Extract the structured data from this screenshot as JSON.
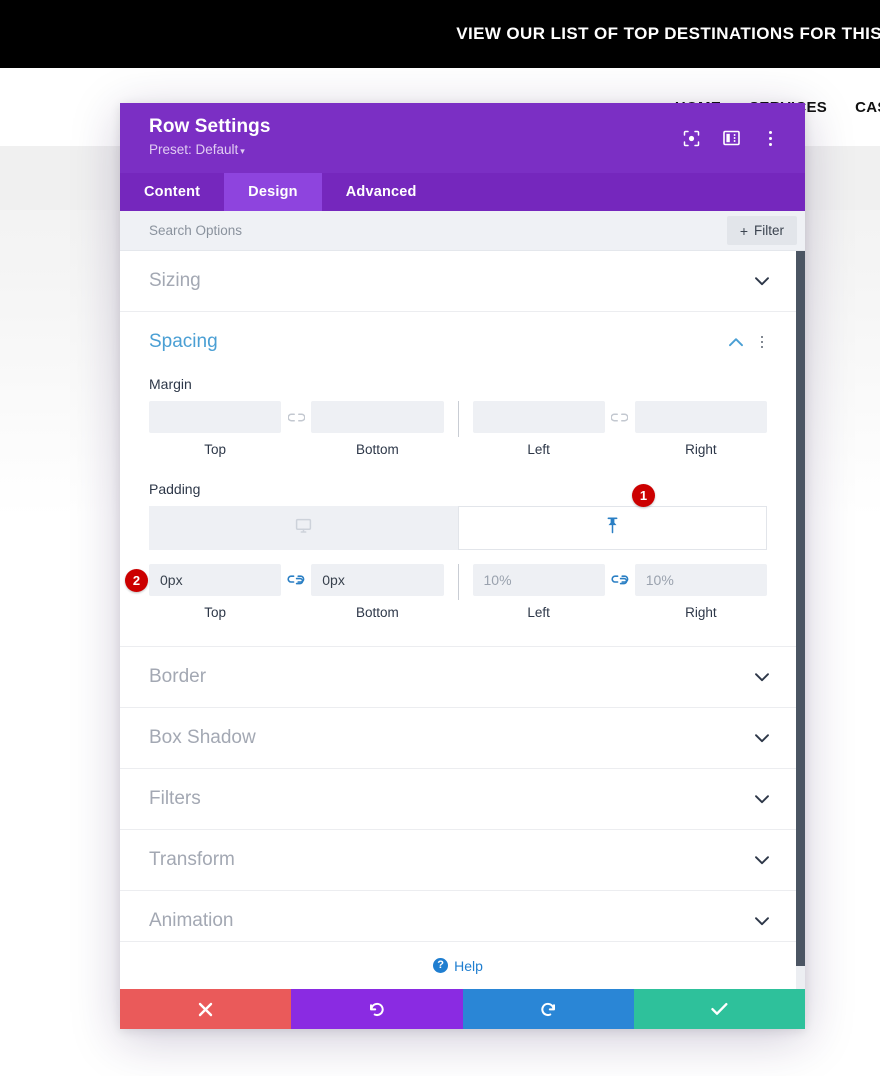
{
  "site": {
    "banner_text": "VIEW OUR LIST OF TOP DESTINATIONS FOR THIS",
    "nav": [
      {
        "label": "HOME"
      },
      {
        "label": "SERVICES"
      },
      {
        "label": "CASE"
      }
    ]
  },
  "modal": {
    "title": "Row Settings",
    "preset_label": "Preset: Default",
    "preset_caret": "▾",
    "header_icons": [
      {
        "name": "focus-icon"
      },
      {
        "name": "layout-panel-icon"
      },
      {
        "name": "more-options-icon"
      }
    ],
    "tabs": [
      {
        "label": "Content",
        "active": false
      },
      {
        "label": "Design",
        "active": true
      },
      {
        "label": "Advanced",
        "active": false
      }
    ],
    "search": {
      "placeholder": "Search Options",
      "value": ""
    },
    "filter_button": {
      "plus": "+",
      "label": "Filter"
    },
    "sections": [
      {
        "name": "sizing",
        "title": "Sizing",
        "open": false
      },
      {
        "name": "spacing",
        "title": "Spacing",
        "open": true
      },
      {
        "name": "border",
        "title": "Border",
        "open": false
      },
      {
        "name": "box-shadow",
        "title": "Box Shadow",
        "open": false
      },
      {
        "name": "filters",
        "title": "Filters",
        "open": false
      },
      {
        "name": "transform",
        "title": "Transform",
        "open": false
      },
      {
        "name": "animation",
        "title": "Animation",
        "open": false
      }
    ],
    "spacing": {
      "margin": {
        "label": "Margin",
        "linked_tb": false,
        "linked_lr": false,
        "top": {
          "value": "",
          "placeholder": "",
          "sublabel": "Top"
        },
        "bottom": {
          "value": "",
          "placeholder": "",
          "sublabel": "Bottom"
        },
        "left": {
          "value": "",
          "placeholder": "",
          "sublabel": "Left"
        },
        "right": {
          "value": "",
          "placeholder": "",
          "sublabel": "Right"
        }
      },
      "padding": {
        "label": "Padding",
        "linked_tb": true,
        "linked_lr": true,
        "responsive_tabs": [
          {
            "name": "desktop-tab",
            "icon": "desktop-icon",
            "active": false
          },
          {
            "name": "pin-tab",
            "icon": "pin-icon",
            "active": true
          }
        ],
        "top": {
          "value": "0px",
          "placeholder": "",
          "sublabel": "Top",
          "muted": false
        },
        "bottom": {
          "value": "0px",
          "placeholder": "",
          "sublabel": "Bottom",
          "muted": false
        },
        "left": {
          "value": "10%",
          "placeholder": "",
          "sublabel": "Left",
          "muted": true
        },
        "right": {
          "value": "10%",
          "placeholder": "",
          "sublabel": "Right",
          "muted": true
        }
      }
    },
    "callouts": [
      {
        "number": "1"
      },
      {
        "number": "2"
      }
    ],
    "help": {
      "icon_glyph": "?",
      "label": "Help"
    },
    "footer_buttons": [
      {
        "name": "cancel-button",
        "icon": "close-icon",
        "color": "#ea5a5a"
      },
      {
        "name": "undo-button",
        "icon": "undo-icon",
        "color": "#8A2BE2"
      },
      {
        "name": "redo-button",
        "icon": "redo-icon",
        "color": "#2a86d6"
      },
      {
        "name": "save-button",
        "icon": "check-icon",
        "color": "#2ec19b"
      }
    ]
  }
}
